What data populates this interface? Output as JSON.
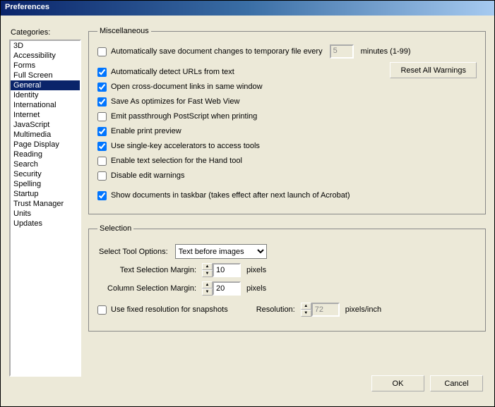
{
  "title": "Preferences",
  "categories_label": "Categories:",
  "categories": [
    "3D",
    "Accessibility",
    "Forms",
    "Full Screen",
    "General",
    "Identity",
    "International",
    "Internet",
    "JavaScript",
    "Multimedia",
    "Page Display",
    "Reading",
    "Search",
    "Security",
    "Spelling",
    "Startup",
    "Trust Manager",
    "Units",
    "Updates"
  ],
  "selected_category_index": 4,
  "misc": {
    "legend": "Miscellaneous",
    "autosave": {
      "checked": false,
      "label": "Automatically save document changes to temporary file every",
      "value": "5",
      "unit": "minutes (1-99)"
    },
    "reset_label": "Reset All Warnings",
    "items": [
      {
        "checked": true,
        "label": "Automatically detect URLs from text"
      },
      {
        "checked": true,
        "label": "Open cross-document links in same window"
      },
      {
        "checked": true,
        "label": "Save As optimizes for Fast Web View"
      },
      {
        "checked": false,
        "label": "Emit passthrough PostScript when printing"
      },
      {
        "checked": true,
        "label": "Enable print preview"
      },
      {
        "checked": true,
        "label": "Use single-key accelerators to access tools"
      },
      {
        "checked": false,
        "label": "Enable text selection for the Hand tool"
      },
      {
        "checked": false,
        "label": "Disable edit warnings"
      },
      {
        "checked": true,
        "label": "Show documents in taskbar (takes effect after next launch of Acrobat)"
      }
    ]
  },
  "selection": {
    "legend": "Selection",
    "select_tool_label": "Select Tool Options:",
    "select_tool_value": "Text before images",
    "text_margin_label": "Text Selection Margin:",
    "text_margin_value": "10",
    "column_margin_label": "Column Selection Margin:",
    "column_margin_value": "20",
    "pixels": "pixels",
    "fixed_res": {
      "checked": false,
      "label": "Use fixed resolution for snapshots"
    },
    "resolution_label": "Resolution:",
    "resolution_value": "72",
    "resolution_unit": "pixels/inch"
  },
  "buttons": {
    "ok": "OK",
    "cancel": "Cancel"
  }
}
